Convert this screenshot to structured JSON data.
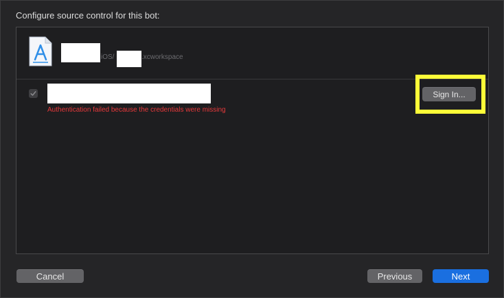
{
  "dialog": {
    "title": "Configure source control for this bot:"
  },
  "project": {
    "icon": "xcode-project-file-icon",
    "path_mid": "iOS/",
    "path_end": ".xcworkspace"
  },
  "repository": {
    "checked": true,
    "error": "Authentication failed because the credentials were missing",
    "sign_in_label": "Sign In..."
  },
  "footer": {
    "cancel_label": "Cancel",
    "previous_label": "Previous",
    "next_label": "Next"
  },
  "colors": {
    "highlight": "#fdfd38",
    "error": "#e8393b",
    "primary": "#1a6fe0"
  }
}
